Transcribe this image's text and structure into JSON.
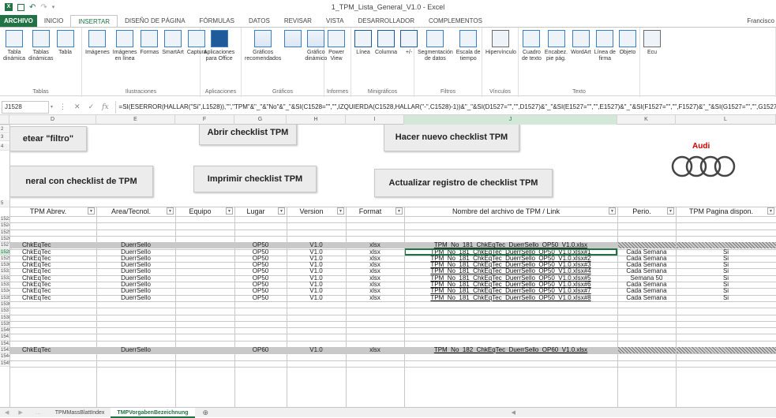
{
  "window": {
    "title": "1_TPM_Lista_General_V1.0 - Excel"
  },
  "ribbon_tabs": [
    "ARCHIVO",
    "INICIO",
    "INSERTAR",
    "DISEÑO DE PÁGINA",
    "FÓRMULAS",
    "DATOS",
    "REVISAR",
    "VISTA",
    "DESARROLLADOR",
    "COMPLEMENTOS"
  ],
  "user": "Francisco",
  "ribbon_groups": [
    {
      "label": "Tablas",
      "buttons": [
        "Tabla\ndinámica",
        "Tablas\ndinámicas",
        "Tabla"
      ]
    },
    {
      "label": "Ilustraciones",
      "buttons": [
        "Imágenes",
        "Imágenes\nen línea",
        "Formas",
        "SmartArt",
        "Captura"
      ]
    },
    {
      "label": "Aplicaciones",
      "buttons": [
        "Aplicaciones\npara Office"
      ]
    },
    {
      "label": "Gráficos",
      "buttons": [
        "Gráficos\nrecomendados",
        "",
        "Gráfico\ndinámico"
      ]
    },
    {
      "label": "Informes",
      "buttons": [
        "Power\nView"
      ]
    },
    {
      "label": "Minigráficos",
      "buttons": [
        "Línea",
        "Columna",
        "+/-"
      ]
    },
    {
      "label": "Filtros",
      "buttons": [
        "Segmentación\nde datos",
        "Escala de\ntiempo"
      ]
    },
    {
      "label": "Vínculos",
      "buttons": [
        "Hipervínculo"
      ]
    },
    {
      "label": "Texto",
      "buttons": [
        "Cuadro\nde texto",
        "Encabez.\npie pág.",
        "WordArt",
        "Línea de\nfirma",
        "Objeto"
      ]
    },
    {
      "label": "",
      "buttons": [
        "Ecu"
      ]
    }
  ],
  "formula_bar": {
    "name_box": "J1528",
    "formula": "=SI(ESERROR(HALLAR(\"Si\",L1528)),\"\",\"TPM\"&\"_\"&\"No\"&\"_\"&SI(C1528=\"\",\"\",IZQUIERDA(C1528,HALLAR(\"-\",C1528)-1))&\"_\"&SI(D1527=\"\",\"\",D1527)&\"_\"&SI(E1527=\"\",\"\",E1527)&\"_\"&SI(F1527=\"\",\"\",F1527)&\"_\"&SI(G1527=\"\",\"\",G1527)"
  },
  "columns": [
    "D",
    "E",
    "F",
    "G",
    "H",
    "I",
    "J",
    "K",
    "L"
  ],
  "buttons": {
    "resetear": "etear \"filtro\"",
    "general": "neral con checklist de TPM",
    "abrir": "Abrir checklist TPM",
    "imprimir": "Imprimir checklist TPM",
    "nuevo": "Hacer nuevo checklist TPM",
    "actualizar": "Actualizar registro de checklist TPM"
  },
  "logo_text": "Audi",
  "table_headers": [
    "TPM Abrev.",
    "Area/Tecnol.",
    "Equipo",
    "Lugar",
    "Version",
    "Format",
    "Nombre del archivo de TPM / Link",
    "Perio.",
    "TPM Pagina dispon."
  ],
  "top_rows": [
    "1",
    "2",
    "3",
    "4",
    "5"
  ],
  "rows": [
    {
      "n": "1523"
    },
    {
      "n": "1524"
    },
    {
      "n": "1525"
    },
    {
      "n": "1526"
    },
    {
      "n": "1527",
      "gray": true,
      "cells": [
        "ChkEqTec",
        "DuerrSello",
        "",
        "OP50",
        "V1.0",
        "xlsx",
        "TPM_No_181_ChkEqTec_DuerrSello_OP50_V1.0.xlsx",
        "",
        ""
      ]
    },
    {
      "n": "1528",
      "active": true,
      "cells": [
        "ChkEqTec",
        "DuerrSello",
        "",
        "OP50",
        "V1.0",
        "xlsx",
        "TPM_No_181_ChkEqTec_DuerrSello_OP50_V1.0.xlsx#1",
        "Cada Semana",
        "Si"
      ]
    },
    {
      "n": "1529",
      "cells": [
        "ChkEqTec",
        "DuerrSello",
        "",
        "OP50",
        "V1.0",
        "xlsx",
        "TPM_No_181_ChkEqTec_DuerrSello_OP50_V1.0.xlsx#2",
        "Cada Semana",
        "Si"
      ]
    },
    {
      "n": "1530",
      "cells": [
        "ChkEqTec",
        "DuerrSello",
        "",
        "OP50",
        "V1.0",
        "xlsx",
        "TPM_No_181_ChkEqTec_DuerrSello_OP50_V1.0.xlsx#3",
        "Cada Semana",
        "Si"
      ]
    },
    {
      "n": "1531",
      "cells": [
        "ChkEqTec",
        "DuerrSello",
        "",
        "OP50",
        "V1.0",
        "xlsx",
        "TPM_No_181_ChkEqTec_DuerrSello_OP50_V1.0.xlsx#4",
        "Cada Semana",
        "Si"
      ]
    },
    {
      "n": "1532",
      "cells": [
        "ChkEqTec",
        "DuerrSello",
        "",
        "OP50",
        "V1.0",
        "xlsx",
        "TPM_No_181_ChkEqTec_DuerrSello_OP50_V1.0.xlsx#5",
        "Semana 50",
        "Si"
      ]
    },
    {
      "n": "1533",
      "cells": [
        "ChkEqTec",
        "DuerrSello",
        "",
        "OP50",
        "V1.0",
        "xlsx",
        "TPM_No_181_ChkEqTec_DuerrSello_OP50_V1.0.xlsx#6",
        "Cada Semana",
        "Si"
      ]
    },
    {
      "n": "1534",
      "cells": [
        "ChkEqTec",
        "DuerrSello",
        "",
        "OP50",
        "V1.0",
        "xlsx",
        "TPM_No_181_ChkEqTec_DuerrSello_OP50_V1.0.xlsx#7",
        "Cada Semana",
        "Si"
      ]
    },
    {
      "n": "1535",
      "cells": [
        "ChkEqTec",
        "DuerrSello",
        "",
        "OP50",
        "V1.0",
        "xlsx",
        "TPM_No_181_ChkEqTec_DuerrSello_OP50_V1.0.xlsx#8",
        "Cada Semana",
        "Si"
      ]
    },
    {
      "n": "1536"
    },
    {
      "n": "1537"
    },
    {
      "n": "1538"
    },
    {
      "n": "1539"
    },
    {
      "n": "1540"
    },
    {
      "n": "1541"
    },
    {
      "n": "1542"
    },
    {
      "n": "1543",
      "gray": true,
      "cells": [
        "ChkEqTec",
        "DuerrSello",
        "",
        "OP60",
        "V1.0",
        "xlsx",
        "TPM_No_182_ChkEqTec_DuerrSello_OP60_V1.0.xlsx",
        "",
        ""
      ]
    },
    {
      "n": "1544"
    },
    {
      "n": "1545"
    }
  ],
  "sheet_tabs": [
    "TPMMassBlattIndex",
    "TMPVorgabenBezeichnung"
  ],
  "colors": {
    "accent": "#217346",
    "gray_row": "#c9c9c9",
    "active_hdr": "#d3e8d9"
  }
}
